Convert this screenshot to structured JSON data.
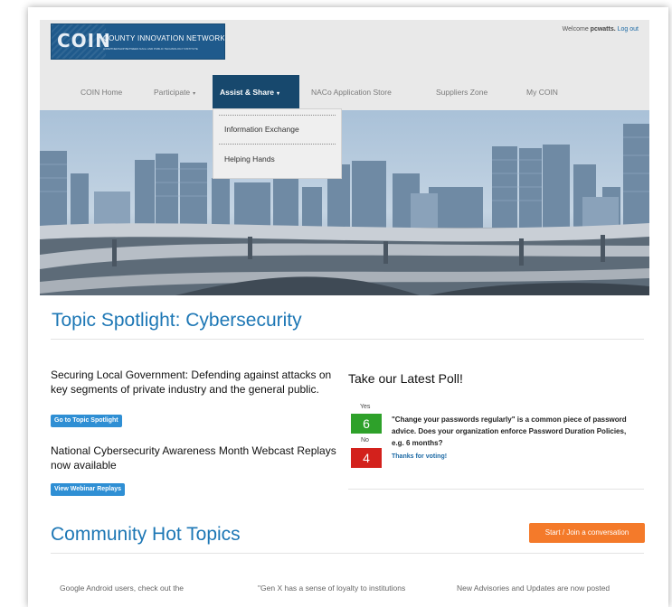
{
  "header": {
    "logo": {
      "name": "COIN",
      "network": "COUNTY INNOVATION NETWORK",
      "tagline": "A PARTNERSHIP BETWEEN NACo AND PUBLIC TECHNOLOGY INSTITUTE"
    },
    "welcome_prefix": "Welcome",
    "username": "pcwatts.",
    "logout": "Log out"
  },
  "nav": {
    "items": [
      {
        "label": "COIN Home"
      },
      {
        "label": "Participate",
        "caret": "▾"
      },
      {
        "label": "Assist & Share",
        "caret": "▾"
      },
      {
        "label": "NACo Application Store"
      },
      {
        "label": "Suppliers Zone"
      },
      {
        "label": "My COIN"
      }
    ],
    "dropdown": [
      "Information Exchange",
      "Helping Hands"
    ]
  },
  "spotlight": {
    "title": "Topic Spotlight: Cybersecurity",
    "article1": "Securing Local Government: Defending against attacks on key segments of private industry and the general public.",
    "article1_button": "Go to Topic Spotlight",
    "article2": "National Cybersecurity Awareness Month Webcast Replays now available",
    "article2_button": "View Webinar Replays"
  },
  "poll": {
    "title": "Take our Latest Poll!",
    "yes_label": "Yes",
    "yes_count": "6",
    "no_label": "No",
    "no_count": "4",
    "question": "\"Change your passwords regularly\" is a common piece of password advice. Does your organization enforce Password Duration Policies, e.g. 6 months?",
    "thanks": "Thanks for voting!",
    "colors": {
      "yes": "#2ea12a",
      "no": "#d3211c"
    }
  },
  "community": {
    "title": "Community Hot Topics",
    "button": "Start / Join a conversation",
    "topics": [
      "Google Android users, check out the",
      "\"Gen X has a sense of loyalty to institutions",
      "New Advisories and Updates are now posted"
    ]
  },
  "colors": {
    "accent": "#1d77b5",
    "nav_active": "#17486d",
    "orange": "#f47a2a"
  }
}
